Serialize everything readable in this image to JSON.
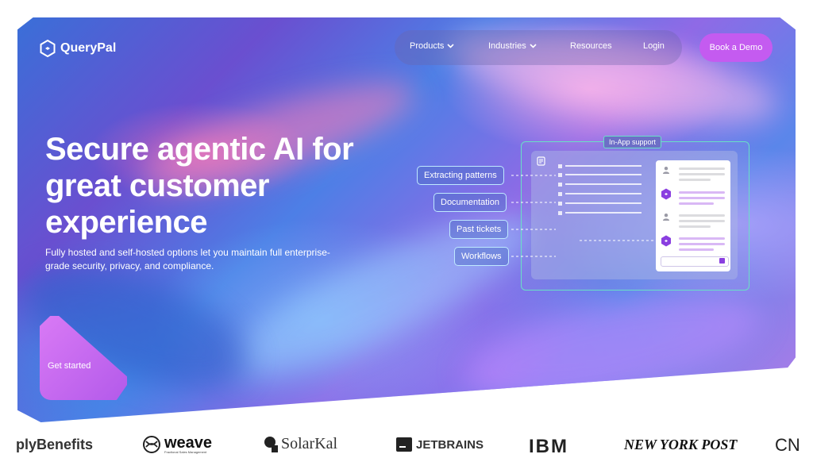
{
  "header": {
    "brand": "QueryPal",
    "nav": [
      {
        "label": "Products",
        "has_dropdown": true
      },
      {
        "label": "Industries",
        "has_dropdown": true
      },
      {
        "label": "Resources",
        "has_dropdown": false
      },
      {
        "label": "Login",
        "has_dropdown": false
      }
    ],
    "cta": "Book a Demo"
  },
  "hero": {
    "headline": "Secure agentic AI for great customer experience",
    "subtext": "Fully hosted and self-hosted options let you maintain full enterprise-grade security, privacy, and compliance.",
    "cta": "Get started"
  },
  "illustration": {
    "title": "In-App support",
    "tags": [
      "Extracting patterns",
      "Documentation",
      "Past tickets",
      "Workflows"
    ]
  },
  "logos": {
    "items": [
      "plyBenefits",
      "weave",
      "SolarKal",
      "JETBRAINS",
      "IBM",
      "NEW YORK POST",
      "CN"
    ],
    "weave_tagline": "Fractional Sales Management"
  },
  "icons": {
    "brand": "querypal-hexagon-icon",
    "chevron": "chevron-down-icon",
    "user": "user-avatar-icon",
    "bot": "bot-hexagon-icon",
    "send": "send-icon"
  },
  "colors": {
    "accent": "#c45bf0",
    "panel_border": "#69e0c6",
    "bot_purple": "#8a3fe0"
  }
}
